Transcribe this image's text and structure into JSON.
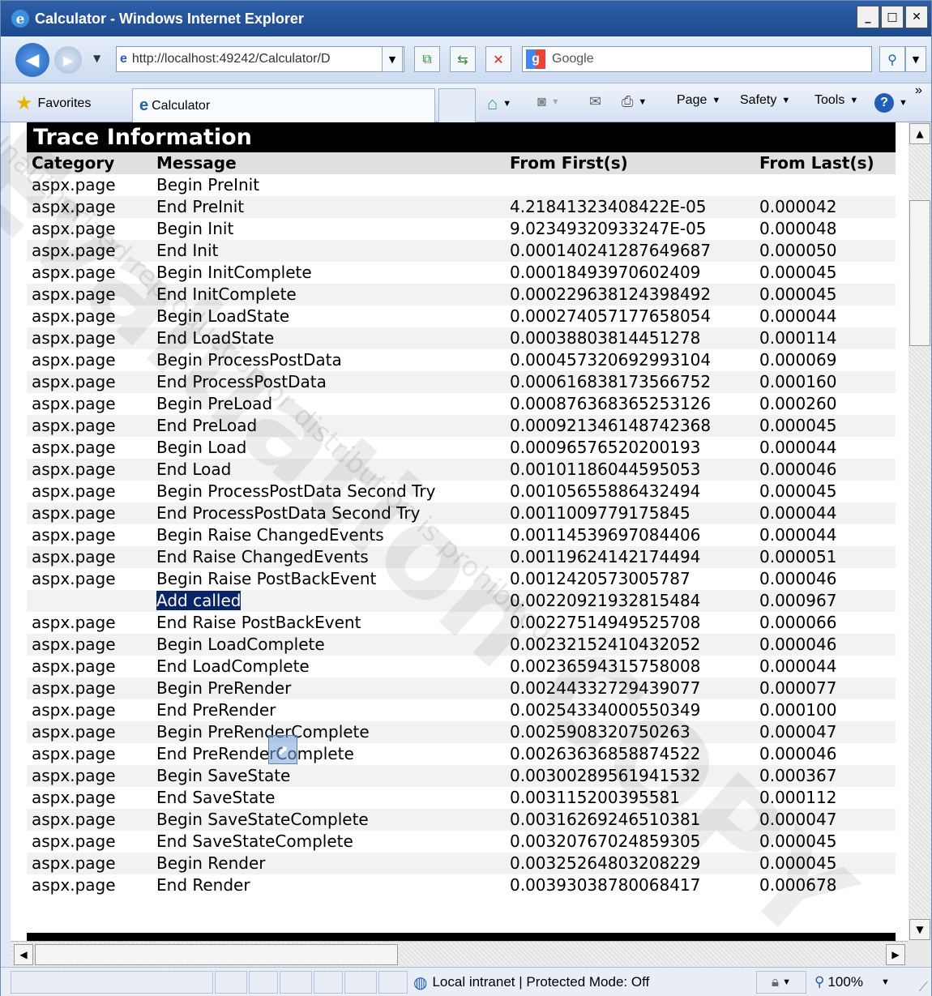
{
  "window": {
    "title": "Calculator - Windows Internet Explorer",
    "min": "_",
    "max": "□",
    "close": "✕"
  },
  "nav": {
    "address": "http://localhost:49242/Calculator/D",
    "search_placeholder": "Google"
  },
  "commandbar": {
    "favorites": "Favorites",
    "tab_title": "Calculator",
    "page": "Page",
    "safety": "Safety",
    "tools": "Tools",
    "help": "?",
    "more": "»"
  },
  "trace": {
    "title": "Trace Information",
    "headers": [
      "Category",
      "Message",
      "From First(s)",
      "From Last(s)"
    ],
    "rows": [
      {
        "category": "aspx.page",
        "message": "Begin PreInit",
        "first": "",
        "last": ""
      },
      {
        "category": "aspx.page",
        "message": "End PreInit",
        "first": "4.21841323408422E-05",
        "last": "0.000042"
      },
      {
        "category": "aspx.page",
        "message": "Begin Init",
        "first": "9.02349320933247E-05",
        "last": "0.000048"
      },
      {
        "category": "aspx.page",
        "message": "End Init",
        "first": "0.000140241287649687",
        "last": "0.000050"
      },
      {
        "category": "aspx.page",
        "message": "Begin InitComplete",
        "first": "0.00018493970602409",
        "last": "0.000045"
      },
      {
        "category": "aspx.page",
        "message": "End InitComplete",
        "first": "0.000229638124398492",
        "last": "0.000045"
      },
      {
        "category": "aspx.page",
        "message": "Begin LoadState",
        "first": "0.000274057177658054",
        "last": "0.000044"
      },
      {
        "category": "aspx.page",
        "message": "End LoadState",
        "first": "0.00038803814451278",
        "last": "0.000114"
      },
      {
        "category": "aspx.page",
        "message": "Begin ProcessPostData",
        "first": "0.000457320692993104",
        "last": "0.000069"
      },
      {
        "category": "aspx.page",
        "message": "End ProcessPostData",
        "first": "0.000616838173566752",
        "last": "0.000160"
      },
      {
        "category": "aspx.page",
        "message": "Begin PreLoad",
        "first": "0.000876368365253126",
        "last": "0.000260"
      },
      {
        "category": "aspx.page",
        "message": "End PreLoad",
        "first": "0.000921346148742368",
        "last": "0.000045"
      },
      {
        "category": "aspx.page",
        "message": "Begin Load",
        "first": "0.00096576520200193",
        "last": "0.000044"
      },
      {
        "category": "aspx.page",
        "message": "End Load",
        "first": "0.00101186044595053",
        "last": "0.000046"
      },
      {
        "category": "aspx.page",
        "message": "Begin ProcessPostData Second Try",
        "first": "0.00105655886432494",
        "last": "0.000045"
      },
      {
        "category": "aspx.page",
        "message": "End ProcessPostData Second Try",
        "first": "0.0011009779175845",
        "last": "0.000044"
      },
      {
        "category": "aspx.page",
        "message": "Begin Raise ChangedEvents",
        "first": "0.00114539697084406",
        "last": "0.000044"
      },
      {
        "category": "aspx.page",
        "message": "End Raise ChangedEvents",
        "first": "0.00119624142174494",
        "last": "0.000051"
      },
      {
        "category": "aspx.page",
        "message": "Begin Raise PostBackEvent",
        "first": "0.0012420573005787",
        "last": "0.000046"
      },
      {
        "category": "",
        "message": "Add called",
        "first": "0.00220921932815484",
        "last": "0.000967",
        "highlight": true
      },
      {
        "category": "aspx.page",
        "message": "End Raise PostBackEvent",
        "first": "0.00227514949525708",
        "last": "0.000066"
      },
      {
        "category": "aspx.page",
        "message": "Begin LoadComplete",
        "first": "0.00232152410432052",
        "last": "0.000046"
      },
      {
        "category": "aspx.page",
        "message": "End LoadComplete",
        "first": "0.00236594315758008",
        "last": "0.000044"
      },
      {
        "category": "aspx.page",
        "message": "Begin PreRender",
        "first": "0.00244332729439077",
        "last": "0.000077"
      },
      {
        "category": "aspx.page",
        "message": "End PreRender",
        "first": "0.00254334000550349",
        "last": "0.000100"
      },
      {
        "category": "aspx.page",
        "message": "Begin PreRenderComplete",
        "first": "0.0025908320750263",
        "last": "0.000047"
      },
      {
        "category": "aspx.page",
        "message": "End PreRenderComplete",
        "first": "0.00263636858874522",
        "last": "0.000046"
      },
      {
        "category": "aspx.page",
        "message": "Begin SaveState",
        "first": "0.00300289561941532",
        "last": "0.000367"
      },
      {
        "category": "aspx.page",
        "message": "End SaveState",
        "first": "0.003115200395581",
        "last": "0.000112"
      },
      {
        "category": "aspx.page",
        "message": "Begin SaveStateComplete",
        "first": "0.00316269246510381",
        "last": "0.000047"
      },
      {
        "category": "aspx.page",
        "message": "End SaveStateComplete",
        "first": "0.00320767024859305",
        "last": "0.000045"
      },
      {
        "category": "aspx.page",
        "message": "Begin Render",
        "first": "0.00325264803208229",
        "last": "0.000045"
      },
      {
        "category": "aspx.page",
        "message": "End Render",
        "first": "0.00393038780068417",
        "last": "0.000678"
      }
    ]
  },
  "status": {
    "zone": "Local intranet | Protected Mode: Off",
    "zoom": "100%"
  },
  "watermark": {
    "large": "Evaluation COPY",
    "small": "Unauthorized reproduction or distribution is prohibited"
  },
  "colors": {
    "title_bar": "#1c4a8f",
    "highlight": "#0a246a",
    "alt_row": "#f2f2f2",
    "header_bg": "#e0e0e0"
  }
}
